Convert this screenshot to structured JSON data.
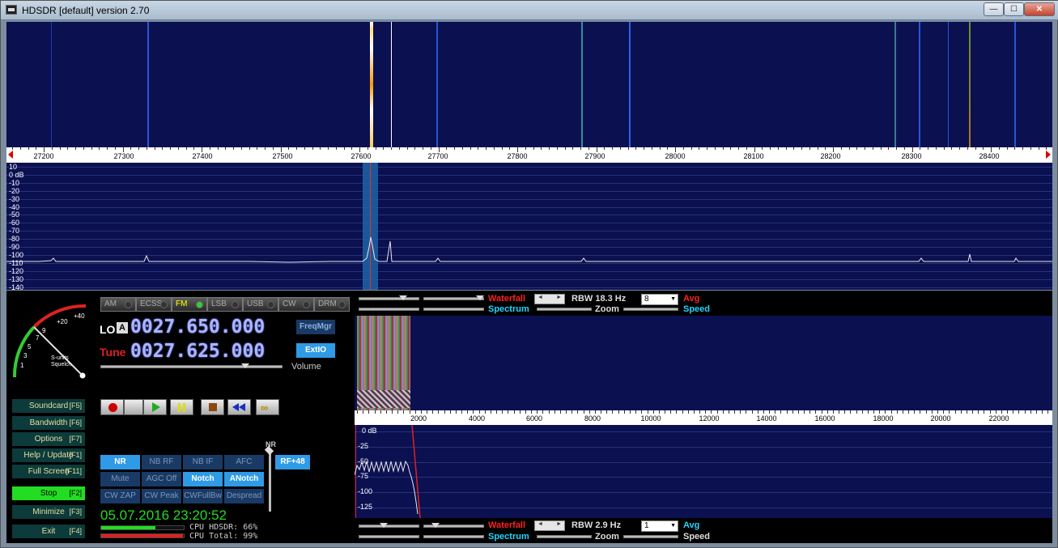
{
  "window": {
    "title": "HDSDR [default]  version 2.70",
    "minimize_glyph": "—",
    "maximize_glyph": "☐",
    "close_glyph": "✕"
  },
  "rf_axis": {
    "labels": [
      "27200",
      "27300",
      "27400",
      "27500",
      "27600",
      "27700",
      "27800",
      "27900",
      "28000",
      "28100",
      "28200",
      "28300",
      "28400"
    ]
  },
  "rf_spectrum": {
    "db_labels": [
      "10",
      "0 dB",
      "-10",
      "-20",
      "-30",
      "-40",
      "-50",
      "-60",
      "-70",
      "-80",
      "-90",
      "-100",
      "-110",
      "-120",
      "-130",
      "-140"
    ]
  },
  "modes": [
    {
      "label": "AM",
      "active": false
    },
    {
      "label": "ECSS",
      "active": false
    },
    {
      "label": "FM",
      "active": true
    },
    {
      "label": "LSB",
      "active": false
    },
    {
      "label": "USB",
      "active": false
    },
    {
      "label": "CW",
      "active": false
    },
    {
      "label": "DRM",
      "active": false
    }
  ],
  "smeter": {
    "scale": [
      "1",
      "3",
      "5",
      "7",
      "9",
      "+20",
      "+40"
    ],
    "caption1": "S-units",
    "caption2": "Squelch"
  },
  "lo": {
    "label": "LO",
    "badge": "A",
    "value": "0027.650.000"
  },
  "tune": {
    "label": "Tune",
    "value": "0027.625.000"
  },
  "buttons": {
    "freqmgr": "FreqMgr",
    "extio": "ExtIO",
    "volume_label": "Volume",
    "rf48": "RF+48",
    "nr_label": "NR"
  },
  "side_buttons": [
    {
      "label": "Soundcard",
      "key": "[F5]",
      "active": false
    },
    {
      "label": "Bandwidth",
      "key": "[F6]",
      "active": false
    },
    {
      "label": "Options",
      "key": "[F7]",
      "active": false
    },
    {
      "label": "Help / Update",
      "key": "[F1]",
      "active": false
    },
    {
      "label": "Full Screen",
      "key": "[F11]",
      "active": false
    },
    {
      "label": "Stop",
      "key": "[F2]",
      "active": true
    },
    {
      "label": "Minimize",
      "key": "[F3]",
      "active": false
    },
    {
      "label": "Exit",
      "key": "[F4]",
      "active": false
    }
  ],
  "dsp_buttons": [
    [
      {
        "label": "NR",
        "on": true
      },
      {
        "label": "NB RF",
        "on": false
      },
      {
        "label": "NB IF",
        "on": false
      },
      {
        "label": "AFC",
        "on": false
      }
    ],
    [
      {
        "label": "Mute",
        "on": false
      },
      {
        "label": "AGC Off",
        "on": false
      },
      {
        "label": "Notch",
        "on": true
      },
      {
        "label": "ANotch",
        "on": true
      }
    ],
    [
      {
        "label": "CW ZAP",
        "on": false
      },
      {
        "label": "CW Peak",
        "on": false
      },
      {
        "label": "CWFullBw",
        "on": false
      },
      {
        "label": "Despread",
        "on": false
      }
    ]
  ],
  "status": {
    "datetime": "05.07.2016 23:20:52",
    "cpu_hdsdr": "CPU HDSDR: 66%",
    "cpu_total": "CPU Total: 99%",
    "cpu_hdsdr_frac": 0.66,
    "cpu_total_frac": 0.99
  },
  "rf_controls": {
    "waterfall": "Waterfall",
    "spectrum": "Spectrum",
    "rbw": "RBW 18.3 Hz",
    "avg_value": "8",
    "avg": "Avg",
    "zoom": "Zoom",
    "speed": "Speed"
  },
  "af_axis": {
    "labels": [
      "2000",
      "4000",
      "6000",
      "8000",
      "10000",
      "12000",
      "14000",
      "16000",
      "18000",
      "20000",
      "22000"
    ]
  },
  "af_spectrum": {
    "db_labels": [
      "0 dB",
      "-25",
      "-50",
      "-75",
      "-100",
      "-125"
    ]
  },
  "af_controls": {
    "waterfall": "Waterfall",
    "spectrum": "Spectrum",
    "rbw": "RBW  2.9 Hz",
    "avg_value": "1",
    "avg": "Avg",
    "zoom": "Zoom",
    "speed": "Speed"
  },
  "colors": {
    "display_bg": "#0b1050",
    "lcd": "#aab4ff",
    "on_button": "#2f9ae6",
    "stop_green": "#22dd22",
    "waterfall_red": "#ff2020",
    "spectrum_cyan": "#22d5ff"
  }
}
